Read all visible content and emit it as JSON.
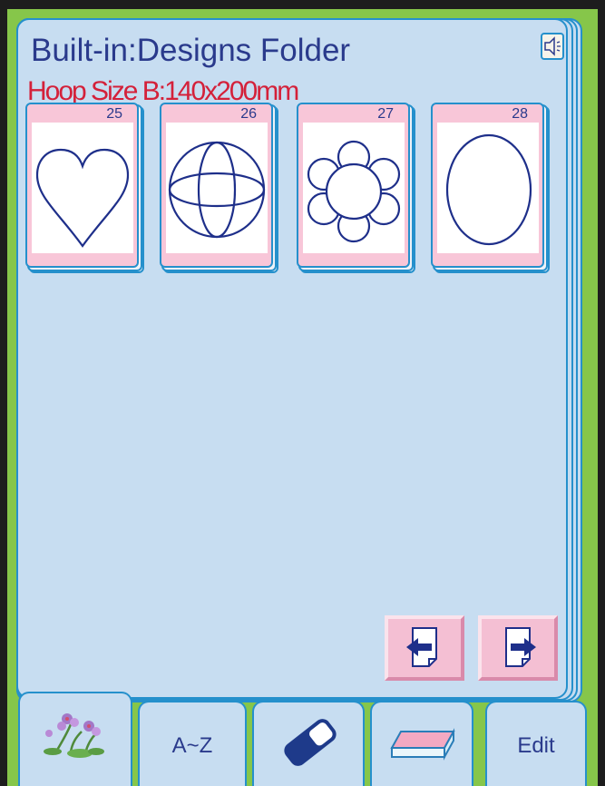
{
  "header": {
    "title": "Built-in:Designs Folder",
    "hoop": "Hoop Size  B:140x200mm"
  },
  "sound": {
    "icon": "speaker-icon"
  },
  "designs": [
    {
      "number": "25",
      "shape": "heart"
    },
    {
      "number": "26",
      "shape": "globe"
    },
    {
      "number": "27",
      "shape": "flower"
    },
    {
      "number": "28",
      "shape": "oval"
    }
  ],
  "nav": {
    "prev_icon": "arrow-left-page-icon",
    "next_icon": "arrow-right-page-icon"
  },
  "tabs": {
    "sort_label": "A~Z",
    "edit_label": "Edit",
    "images_icon": "flowers-icon",
    "eraser_icon": "eraser-icon",
    "tray_icon": "tray-icon"
  },
  "colors": {
    "panel": "#c7ddf1",
    "border": "#2590cc",
    "title": "#2a3a8c",
    "hoop": "#d4213a",
    "card": "#f8c6d8",
    "frame": "#86c64a"
  }
}
